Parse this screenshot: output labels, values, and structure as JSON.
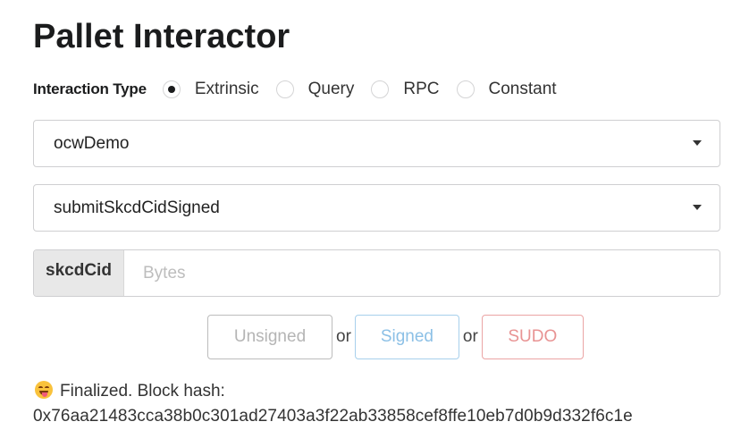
{
  "page": {
    "title": "Pallet Interactor"
  },
  "interaction": {
    "label": "Interaction Type",
    "options": [
      {
        "label": "Extrinsic",
        "checked": true
      },
      {
        "label": "Query",
        "checked": false
      },
      {
        "label": "RPC",
        "checked": false
      },
      {
        "label": "Constant",
        "checked": false
      }
    ]
  },
  "pallet_dropdown": {
    "value": "ocwDemo",
    "icon": "dropdown-caret"
  },
  "call_dropdown": {
    "value": "submitSkcdCidSigned",
    "icon": "dropdown-caret"
  },
  "param": {
    "label": "skcdCid",
    "placeholder": "Bytes",
    "value": ""
  },
  "buttons": {
    "unsigned": "Unsigned",
    "or1": "or",
    "signed": "Signed",
    "or2": "or",
    "sudo": "SUDO"
  },
  "status": {
    "icon": "grinning-tongue-emoji",
    "text": "Finalized. Block hash:",
    "hash": "0x76aa21483cca38b0c301ad27403a3f22ab33858cef8ffe10eb7d0b9d332f6c1e"
  },
  "colors": {
    "signed": "#8cc0e6",
    "sudo": "#e89393",
    "unsigned": "#b5b5b5"
  }
}
